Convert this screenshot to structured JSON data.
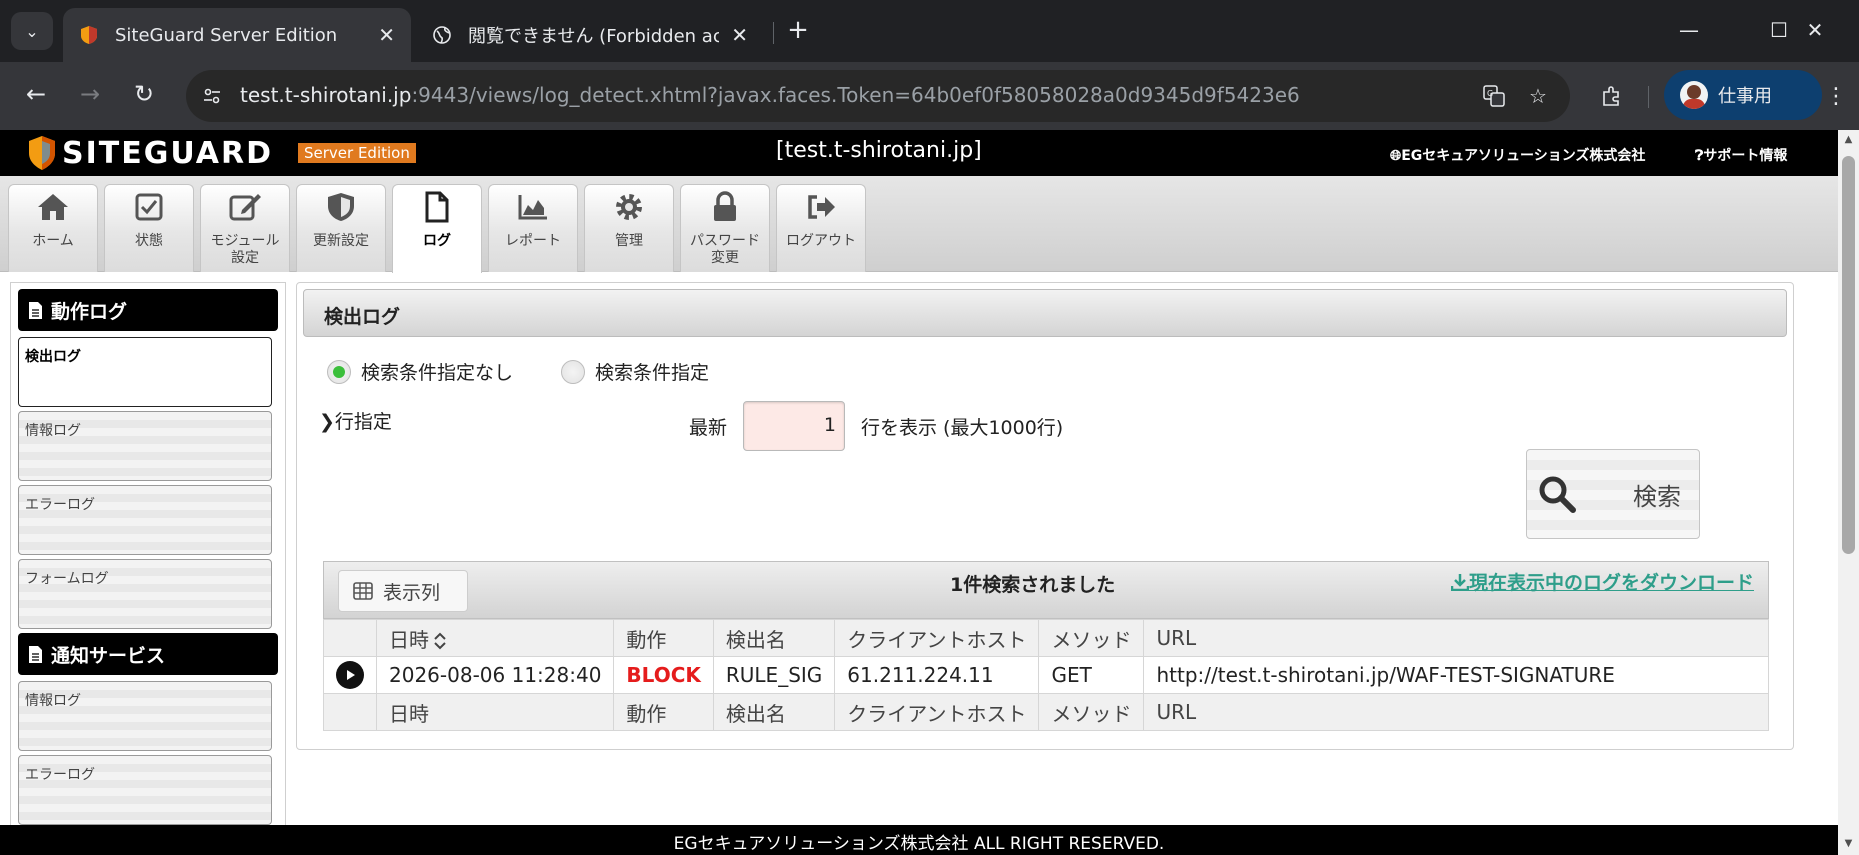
{
  "browser": {
    "tabs": [
      {
        "title": "SiteGuard Server Edition",
        "active": true
      },
      {
        "title": "閲覧できません (Forbidden access)",
        "active": false
      }
    ],
    "url": {
      "host": "test.t-shirotani.jp",
      "rest": ":9443/views/log_detect.xhtml?javax.faces.Token=64b0ef0f58058028a0d9345d9f5423e6"
    },
    "profile_label": "仕事用"
  },
  "header": {
    "logo_text": "SITEGUARD",
    "logo_badge": "Server Edition",
    "host_title": "[test.t-shirotani.jp]",
    "company_link": "EGセキュアソリューションズ株式会社",
    "support_link": "サポート情報"
  },
  "nav": {
    "tabs": [
      {
        "label": "ホーム",
        "icon": "home-icon"
      },
      {
        "label": "状態",
        "icon": "checkbox-icon"
      },
      {
        "label": "モジュール\n設定",
        "icon": "edit-icon"
      },
      {
        "label": "更新設定",
        "icon": "shield-icon"
      },
      {
        "label": "ログ",
        "icon": "document-icon",
        "active": true
      },
      {
        "label": "レポート",
        "icon": "chart-icon"
      },
      {
        "label": "管理",
        "icon": "gear-icon"
      },
      {
        "label": "パスワード\n変更",
        "icon": "lock-icon"
      },
      {
        "label": "ログアウト",
        "icon": "logout-icon"
      }
    ]
  },
  "sidebar": {
    "section1": "動作ログ",
    "items1": [
      "検出ログ",
      "情報ログ",
      "エラーログ",
      "フォームログ"
    ],
    "section2": "通知サービス",
    "items2": [
      "情報ログ",
      "エラーログ"
    ]
  },
  "content": {
    "title": "検出ログ",
    "radio_none": "検索条件指定なし",
    "radio_spec": "検索条件指定",
    "row_spec": "行指定",
    "latest_label": "最新",
    "latest_value": "1",
    "rows_label": "行を表示 (最大1000行)",
    "search_button": "検索",
    "columns_button": "表示列",
    "result_count": "1件検索されました",
    "download_link": "現在表示中のログをダウンロード",
    "table": {
      "headers": [
        "日時",
        "動作",
        "検出名",
        "クライアントホスト",
        "メソッド",
        "URL"
      ],
      "rows": [
        [
          "2026-08-06 11:28:40",
          "BLOCK",
          "RULE_SIG",
          "61.211.224.11",
          "GET",
          "http://test.t-shirotani.jp/WAF-TEST-SIGNATURE"
        ]
      ]
    }
  },
  "footer": "EGセキュアソリューションズ株式会社 ALL RIGHT RESERVED.",
  "colors": {
    "accent_green": "#3bbf3b",
    "block_red": "#e51c1c",
    "link_teal": "#2e9e8a",
    "badge_orange": "#e07a1f"
  }
}
